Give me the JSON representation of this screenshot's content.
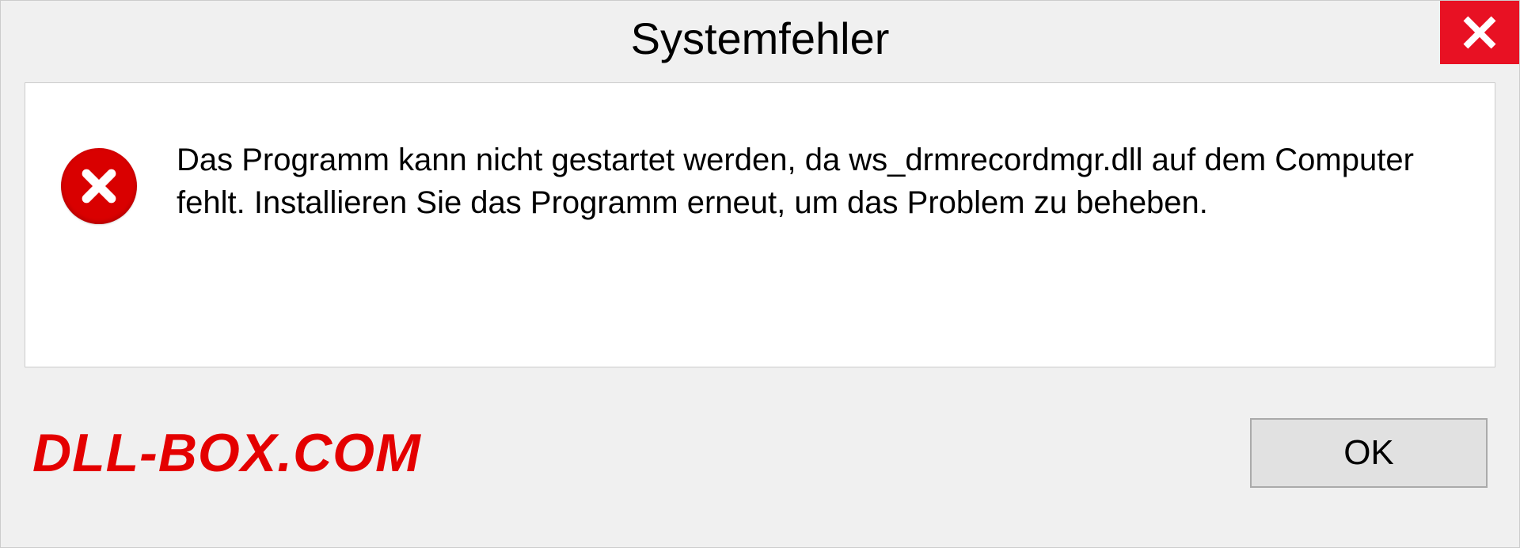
{
  "dialog": {
    "title": "Systemfehler",
    "message": "Das Programm kann nicht gestartet werden, da ws_drmrecordmgr.dll auf dem Computer fehlt. Installieren Sie das Programm erneut, um das Problem zu beheben.",
    "ok_label": "OK"
  },
  "watermark": "DLL-BOX.COM",
  "icons": {
    "close": "close-icon",
    "error": "error-icon"
  },
  "colors": {
    "close_bg": "#e81123",
    "error_bg": "#d90000",
    "watermark": "#e40000"
  }
}
